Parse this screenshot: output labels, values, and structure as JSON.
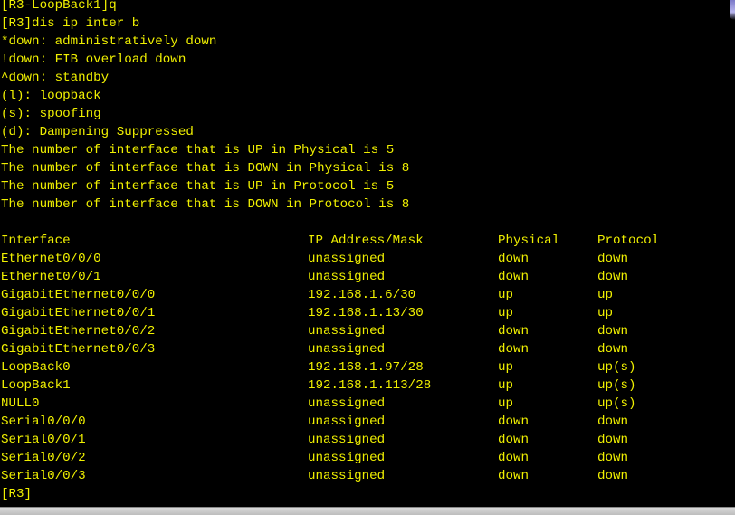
{
  "terminal": {
    "prompt_exit": "[R3-LoopBack1]q",
    "command": "[R3]dis ip inter b",
    "legend": [
      "*down: administratively down",
      "!down: FIB overload down",
      "^down: standby",
      "(l): loopback",
      "(s): spoofing",
      "(d): Dampening Suppressed"
    ],
    "summary": [
      "The number of interface that is UP in Physical is 5",
      "The number of interface that is DOWN in Physical is 8",
      "The number of interface that is UP in Protocol is 5",
      "The number of interface that is DOWN in Protocol is 8"
    ],
    "table": {
      "headers": {
        "interface": "Interface",
        "ip": "IP Address/Mask",
        "physical": "Physical",
        "protocol": "Protocol"
      },
      "rows": [
        {
          "interface": "Ethernet0/0/0",
          "ip": "unassigned",
          "physical": "down",
          "protocol": "down"
        },
        {
          "interface": "Ethernet0/0/1",
          "ip": "unassigned",
          "physical": "down",
          "protocol": "down"
        },
        {
          "interface": "GigabitEthernet0/0/0",
          "ip": "192.168.1.6/30",
          "physical": "up",
          "protocol": "up"
        },
        {
          "interface": "GigabitEthernet0/0/1",
          "ip": "192.168.1.13/30",
          "physical": "up",
          "protocol": "up"
        },
        {
          "interface": "GigabitEthernet0/0/2",
          "ip": "unassigned",
          "physical": "down",
          "protocol": "down"
        },
        {
          "interface": "GigabitEthernet0/0/3",
          "ip": "unassigned",
          "physical": "down",
          "protocol": "down"
        },
        {
          "interface": "LoopBack0",
          "ip": "192.168.1.97/28",
          "physical": "up",
          "protocol": "up(s)"
        },
        {
          "interface": "LoopBack1",
          "ip": "192.168.1.113/28",
          "physical": "up",
          "protocol": "up(s)"
        },
        {
          "interface": "NULL0",
          "ip": "unassigned",
          "physical": "up",
          "protocol": "up(s)"
        },
        {
          "interface": "Serial0/0/0",
          "ip": "unassigned",
          "physical": "down",
          "protocol": "down"
        },
        {
          "interface": "Serial0/0/1",
          "ip": "unassigned",
          "physical": "down",
          "protocol": "down"
        },
        {
          "interface": "Serial0/0/2",
          "ip": "unassigned",
          "physical": "down",
          "protocol": "down"
        },
        {
          "interface": "Serial0/0/3",
          "ip": "unassigned",
          "physical": "down",
          "protocol": "down"
        }
      ]
    },
    "final_prompt": "[R3]"
  },
  "colors": {
    "background": "#000000",
    "text": "#f0f000"
  }
}
